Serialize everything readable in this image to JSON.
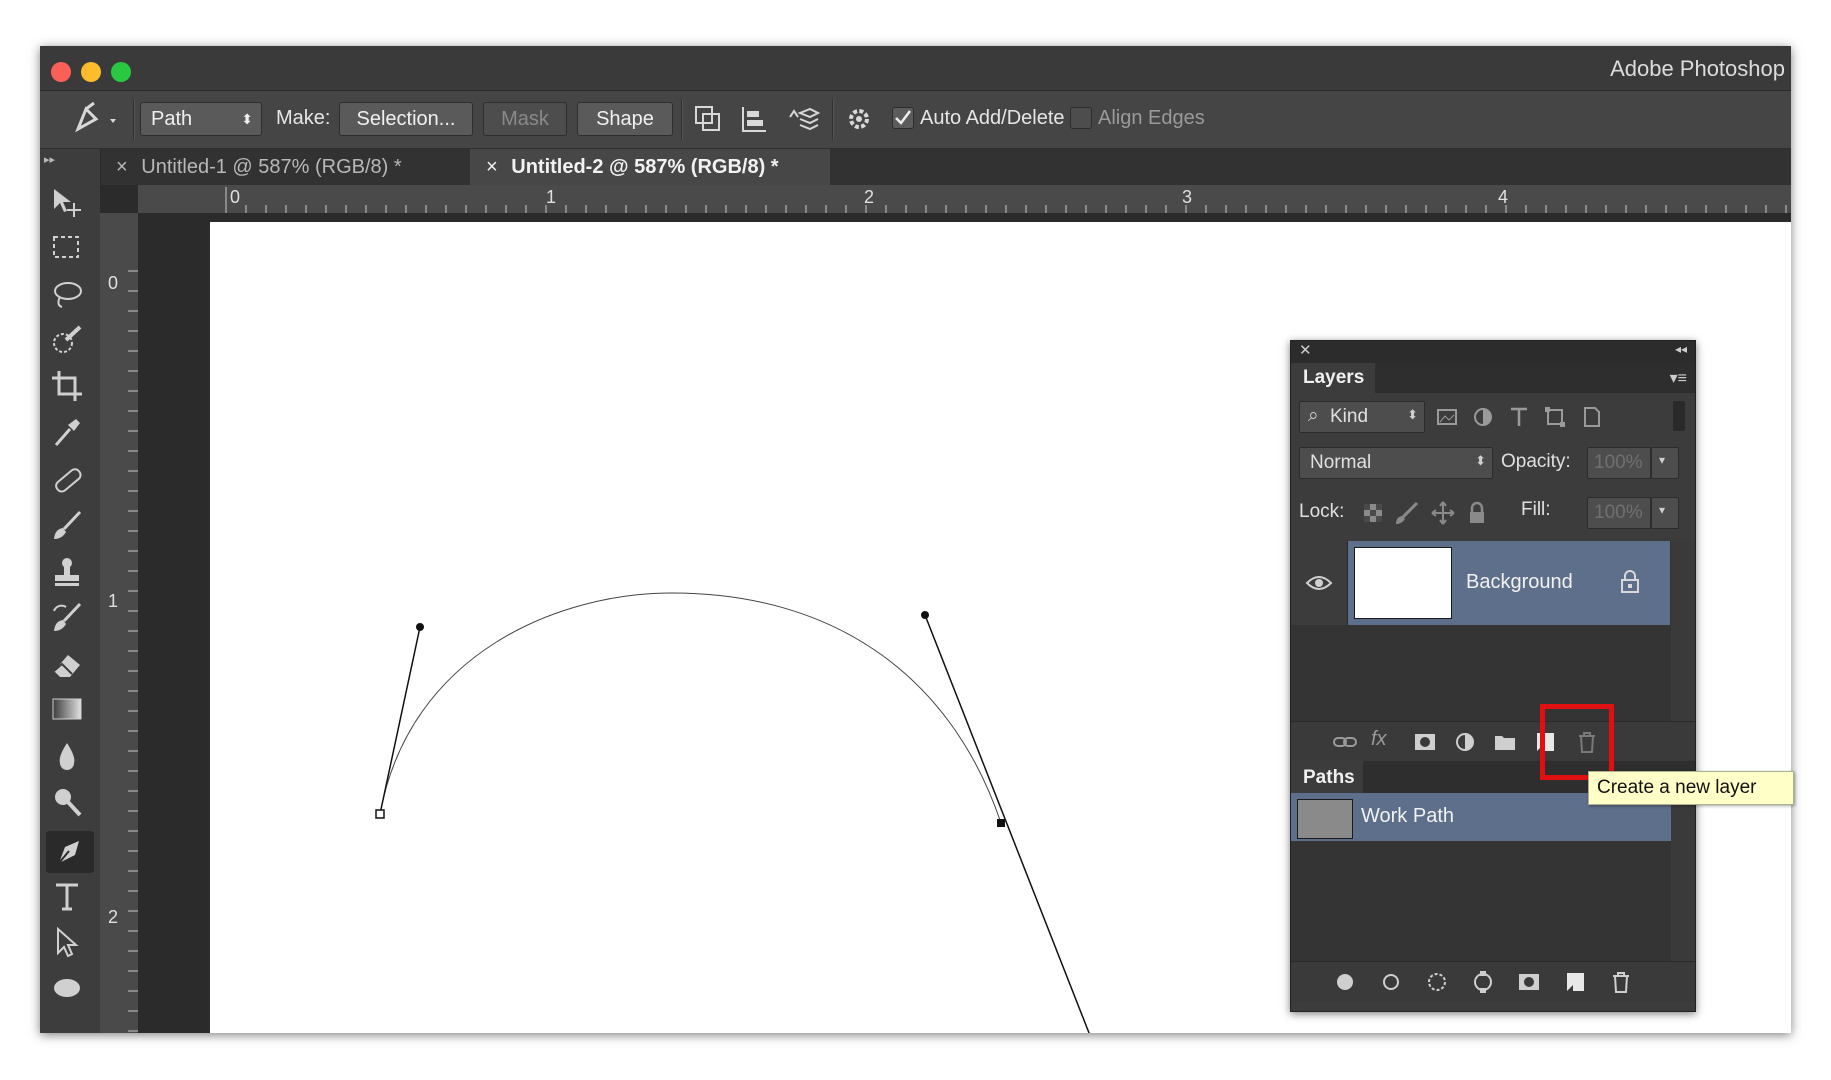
{
  "window": {
    "title": "Adobe Photoshop"
  },
  "options": {
    "mode_value": "Path",
    "make_label": "Make:",
    "selection_button": "Selection...",
    "mask_button": "Mask",
    "shape_button": "Shape",
    "auto_add_label": "Auto Add/Delete",
    "auto_add_checked": true,
    "align_edges_label": "Align Edges",
    "align_edges_checked": false
  },
  "tabs": [
    {
      "close": "×",
      "label": "Untitled-1 @ 587% (RGB/8) *"
    },
    {
      "close": "×",
      "label": "Untitled-2 @ 587% (RGB/8) *"
    }
  ],
  "rulers": {
    "top": [
      "0",
      "1",
      "2",
      "3",
      "4"
    ],
    "left": [
      "0",
      "1",
      "2"
    ]
  },
  "toolbar": {
    "tools": [
      "move-icon",
      "marquee-icon",
      "lasso-icon",
      "quick-select-icon",
      "crop-icon",
      "eyedropper-icon",
      "healing-icon",
      "brush-icon",
      "stamp-icon",
      "history-brush-icon",
      "eraser-icon",
      "gradient-icon",
      "blur-icon",
      "dodge-icon",
      "pen-icon",
      "type-icon",
      "path-select-icon",
      "ellipse-icon"
    ],
    "active_tool": "pen-icon"
  },
  "layers_panel": {
    "title": "Layers",
    "filter_kind": "Kind",
    "blend_mode": "Normal",
    "opacity_label": "Opacity:",
    "opacity_value": "100%",
    "lock_label": "Lock:",
    "fill_label": "Fill:",
    "fill_value": "100%",
    "layers": [
      {
        "name": "Background",
        "visible": true,
        "locked": true
      }
    ]
  },
  "paths_panel": {
    "title": "Paths",
    "paths": [
      {
        "name": "Work Path"
      }
    ]
  },
  "tooltip": {
    "text": "Create a new layer"
  },
  "colors": {
    "highlight": "#e01010",
    "selected_row": "#5d6f8a"
  }
}
